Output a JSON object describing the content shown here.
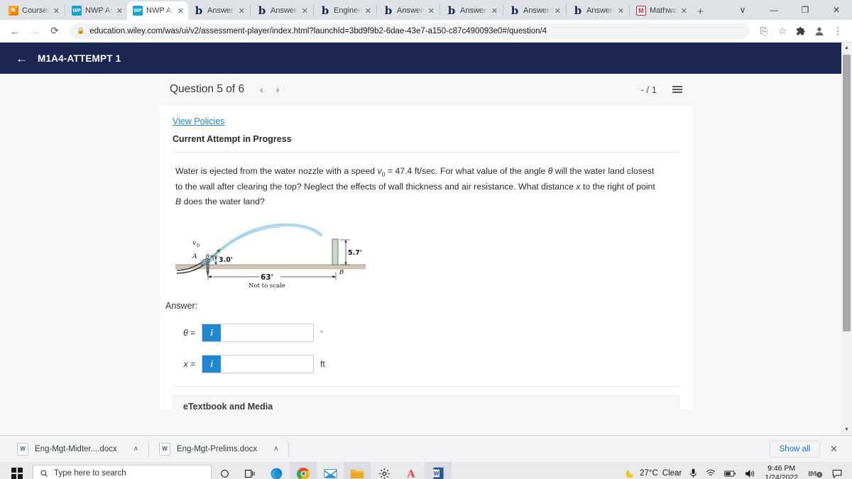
{
  "browser": {
    "tabs": [
      {
        "label": "Courses",
        "icon": "canvas-icon",
        "active": false
      },
      {
        "label": "NWP Ass",
        "icon": "wileyplus-icon",
        "active": false
      },
      {
        "label": "NWP Ass",
        "icon": "wileyplus-icon",
        "active": true
      },
      {
        "label": "Answered",
        "icon": "chegg-icon",
        "active": false
      },
      {
        "label": "Answered",
        "icon": "chegg-icon",
        "active": false
      },
      {
        "label": "Engineeri",
        "icon": "chegg-icon",
        "active": false
      },
      {
        "label": "Answered",
        "icon": "chegg-icon",
        "active": false
      },
      {
        "label": "Answered",
        "icon": "chegg-icon",
        "active": false
      },
      {
        "label": "Answered",
        "icon": "chegg-icon",
        "active": false
      },
      {
        "label": "Answered",
        "icon": "chegg-icon",
        "active": false
      },
      {
        "label": "Mathway",
        "icon": "mathway-icon",
        "active": false
      }
    ],
    "new_tab_label": "+",
    "tab_close_label": "✕",
    "window_controls": {
      "more": "∨",
      "minimize": "—",
      "maximize": "❐",
      "close": "✕"
    },
    "toolbar": {
      "back": "←",
      "forward": "→",
      "reload": "⟳",
      "lock": "🔒",
      "url": "education.wiley.com/was/ui/v2/assessment-player/index.html?launchId=3bd9f9b2-6dae-43e7-a150-c87c490093e0#/question/4",
      "share": "⎘",
      "bookmark": "☆",
      "extensions": "❖",
      "profile": "●",
      "menu": "⋮"
    }
  },
  "app_header": {
    "back_label": "←",
    "title": "M1A4-ATTEMPT 1"
  },
  "question_header": {
    "title": "Question 5 of 6",
    "prev": "‹",
    "next": "›",
    "score": "- / 1",
    "list_icon": "question-list-icon"
  },
  "question": {
    "view_policies": "View Policies",
    "attempt_status": "Current Attempt in Progress",
    "text_part1": "Water is ejected from the water nozzle with a speed ",
    "v0_symbol": "v",
    "v0_sub": "0",
    "text_part2": " = 47.4 ft/sec. For what value of the angle ",
    "theta_symbol": "θ",
    "text_part3": " will the water land closest to the wall after clearing the top? Neglect the effects of wall thickness and air resistance. What distance ",
    "x_symbol": "x",
    "text_part4": " to the right of point ",
    "b_symbol": "B",
    "text_part5": " does the water land?"
  },
  "figure": {
    "name": "projectile-water-nozzle-diagram",
    "point_a": "A",
    "point_b": "B",
    "velocity_label": "v",
    "velocity_sub": "0",
    "angle_label": "θ",
    "nozzle_height": "3.0'",
    "wall_height": "5.7'",
    "horizontal_distance": "63'",
    "note": "Not to scale"
  },
  "answer": {
    "label": "Answer:",
    "fields": [
      {
        "var": "θ =",
        "value": "",
        "placeholder": "",
        "unit": "°",
        "badge": "i"
      },
      {
        "var": "x =",
        "value": "",
        "placeholder": "",
        "unit": "ft",
        "badge": "i"
      }
    ]
  },
  "etextbook": {
    "label": "eTextbook and Media"
  },
  "downloads": {
    "items": [
      {
        "name": "Eng-Mgt-Midter....docx",
        "caret": "∧"
      },
      {
        "name": "Eng-Mgt-Prelims.docx",
        "caret": "∧"
      }
    ],
    "show_all": "Show all",
    "close": "✕"
  },
  "taskbar": {
    "start_icon": "windows-start-icon",
    "search_placeholder": "Type here to search",
    "search_icon": "search-icon",
    "task_view_icon": "task-view-icon",
    "cortana_icon": "cortana-circle-icon",
    "apps": [
      {
        "name": "edge-icon",
        "active": false
      },
      {
        "name": "chrome-icon",
        "active": true
      },
      {
        "name": "mail-icon",
        "active": false
      },
      {
        "name": "file-explorer-icon",
        "active": true
      },
      {
        "name": "settings-gear-icon",
        "active": false
      },
      {
        "name": "autodesk-icon",
        "active": false
      },
      {
        "name": "word-icon",
        "active": true
      }
    ],
    "weather": {
      "icon": "moon-icon",
      "temp": "27°C",
      "condition": "Clear"
    },
    "tray_icons": [
      "microphone-icon",
      "wifi-icon",
      "battery-icon",
      "volume-icon"
    ],
    "time": "9:46 PM",
    "date": "1/24/2022",
    "notification_badge": "1",
    "action_center_icon": "action-center-icon"
  },
  "colors": {
    "wiley_navy": "#1c2653",
    "link_blue": "#1e88d2",
    "badge_blue": "#1e88d2",
    "chrome_tabstrip": "#dee1e6"
  }
}
